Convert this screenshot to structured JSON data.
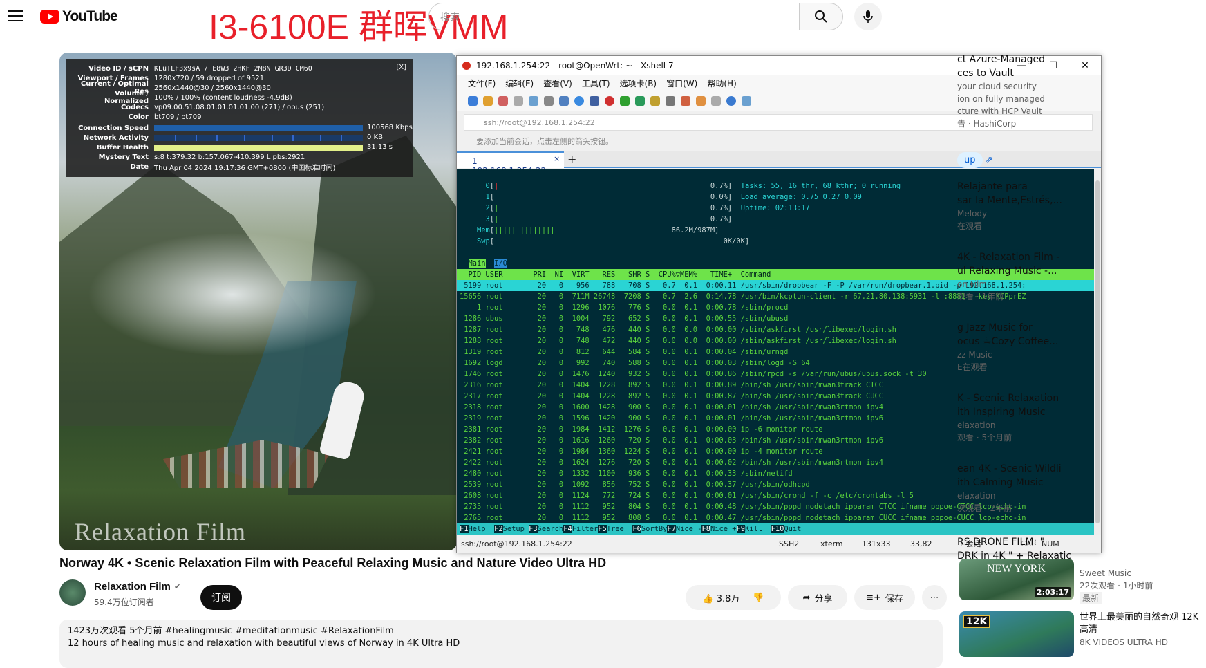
{
  "youtube": {
    "brand": "YouTube",
    "overlay": "I3-6100E 群晖VMM",
    "search_placeholder": "搜索"
  },
  "stats": {
    "close": "[X]",
    "rows": [
      {
        "k": "Video ID / sCPN",
        "v": "KLuTLF3x9sA / E8W3 2HKF 2M8N GR3D CM60"
      },
      {
        "k": "Viewport / Frames",
        "v": "1280x720 / 59 dropped of 9521"
      },
      {
        "k": "Current / Optimal Res",
        "v": "2560x1440@30 / 2560x1440@30"
      },
      {
        "k": "Volume / Normalized",
        "v": "100% / 100% (content loudness -4.9dB)"
      },
      {
        "k": "Codecs",
        "v": "vp09.00.51.08.01.01.01.01.00 (271) / opus (251)"
      },
      {
        "k": "Color",
        "v": "bt709 / bt709"
      }
    ],
    "speed": {
      "k": "Connection Speed",
      "v": "100568 Kbps"
    },
    "activity": {
      "k": "Network Activity",
      "v": "0 KB"
    },
    "buffer": {
      "k": "Buffer Health",
      "v": "31.13 s"
    },
    "mystery": {
      "k": "Mystery Text",
      "v": "s:8 t:379.32 b:157.067-410.399 L pbs:2921"
    },
    "date": {
      "k": "Date",
      "v": "Thu Apr 04 2024 19:17:36 GMT+0800 (中国标准时间)"
    }
  },
  "watermark": "Relaxation Film",
  "xshell": {
    "title": "192.168.1.254:22 - root@OpenWrt: ~ - Xshell 7",
    "menu": [
      "文件(F)",
      "编辑(E)",
      "查看(V)",
      "工具(T)",
      "选项卡(B)",
      "窗口(W)",
      "帮助(H)"
    ],
    "address": "ssh://root@192.168.1.254:22",
    "hint": "要添加当前会话，点击左侧的箭头按钮。",
    "tab": "1 192.168.1.254:22",
    "status": {
      "conn": "ssh://root@192.168.1.254:22",
      "proto": "SSH2",
      "term": "xterm",
      "size": "131x33",
      "pos": "33,82",
      "sessions": "1 会话",
      "caps": "CAP",
      "num": "NUM"
    },
    "terminal": {
      "cpus": [
        {
          "n": "0",
          "bar": "|",
          "pct": "0.7%"
        },
        {
          "n": "1",
          "bar": "",
          "pct": "0.0%"
        },
        {
          "n": "2",
          "bar": "|",
          "pct": "0.7%"
        },
        {
          "n": "3",
          "bar": "|",
          "pct": "0.7%"
        }
      ],
      "mem": {
        "label": "Mem",
        "bar": "||||||||||||||",
        "val": "86.2M/987M"
      },
      "swp": {
        "label": "Swp",
        "bar": "",
        "val": "0K/0K"
      },
      "tasks": "Tasks: 55, 16 thr, 68 kthr; 0 running",
      "load": "Load average: 0.75 0.27 0.09",
      "uptime": "Uptime: 02:13:17",
      "tabs": [
        "Main",
        "I/O"
      ],
      "header": "  PID USER       PRI  NI  VIRT   RES   SHR S  CPU%▽MEM%   TIME+  Command",
      "rows": [
        " 5199 root        20   0   956   788   708 S   0.7  0.1  0:00.11 /usr/sbin/dropbear -F -P /var/run/dropbear.1.pid -p 192.168.1.254:",
        "15656 root        20   0  711M 26748  7208 S   0.7  2.6  0:14.78 /usr/bin/kcptun-client -r 67.21.80.138:5931 -l :8881 --key KCPprEZ",
        "    1 root        20   0  1296  1076   776 S   0.0  0.1  0:00.78 /sbin/procd",
        " 1286 ubus        20   0  1004   792   652 S   0.0  0.1  0:00.55 /sbin/ubusd",
        " 1287 root        20   0   748   476   440 S   0.0  0.0  0:00.00 /sbin/askfirst /usr/libexec/login.sh",
        " 1288 root        20   0   748   472   440 S   0.0  0.0  0:00.00 /sbin/askfirst /usr/libexec/login.sh",
        " 1319 root        20   0   812   644   584 S   0.0  0.1  0:00.04 /sbin/urngd",
        " 1692 logd        20   0   992   740   588 S   0.0  0.1  0:00.03 /sbin/logd -S 64",
        " 1746 root        20   0  1476  1240   932 S   0.0  0.1  0:00.86 /sbin/rpcd -s /var/run/ubus/ubus.sock -t 30",
        " 2316 root        20   0  1404  1228   892 S   0.0  0.1  0:00.89 /bin/sh /usr/sbin/mwan3track CTCC",
        " 2317 root        20   0  1404  1228   892 S   0.0  0.1  0:00.87 /bin/sh /usr/sbin/mwan3track CUCC",
        " 2318 root        20   0  1600  1428   900 S   0.0  0.1  0:00.01 /bin/sh /usr/sbin/mwan3rtmon ipv4",
        " 2319 root        20   0  1596  1420   900 S   0.0  0.1  0:00.01 /bin/sh /usr/sbin/mwan3rtmon ipv6",
        " 2381 root        20   0  1984  1412  1276 S   0.0  0.1  0:00.00 ip -6 monitor route",
        " 2382 root        20   0  1616  1260   720 S   0.0  0.1  0:00.03 /bin/sh /usr/sbin/mwan3rtmon ipv6",
        " 2421 root        20   0  1984  1360  1224 S   0.0  0.1  0:00.00 ip -4 monitor route",
        " 2422 root        20   0  1624  1276   720 S   0.0  0.1  0:00.02 /bin/sh /usr/sbin/mwan3rtmon ipv4",
        " 2480 root        20   0  1332  1100   936 S   0.0  0.1  0:00.33 /sbin/netifd",
        " 2539 root        20   0  1092   856   752 S   0.0  0.1  0:00.37 /usr/sbin/odhcpd",
        " 2608 root        20   0  1124   772   724 S   0.0  0.1  0:00.01 /usr/sbin/crond -f -c /etc/crontabs -l 5",
        " 2735 root        20   0  1112   952   804 S   0.0  0.1  0:00.48 /usr/sbin/pppd nodetach ipparam CTCC ifname pppoe-CTCC lcp-echo-in",
        " 2765 root        20   0  1112   952   808 S   0.0  0.1  0:00.47 /usr/sbin/pppd nodetach ipparam CUCC ifname pppoe-CUCC lcp-echo-in"
      ],
      "fkeys": [
        {
          "k": "F1",
          "l": "Help  "
        },
        {
          "k": "F2",
          "l": "Setup "
        },
        {
          "k": "F3",
          "l": "Search"
        },
        {
          "k": "F4",
          "l": "Filter"
        },
        {
          "k": "F5",
          "l": "Tree  "
        },
        {
          "k": "F6",
          "l": "SortBy"
        },
        {
          "k": "F7",
          "l": "Nice -"
        },
        {
          "k": "F8",
          "l": "Nice +"
        },
        {
          "k": "F9",
          "l": "Kill  "
        },
        {
          "k": "F10",
          "l": "Quit"
        }
      ]
    }
  },
  "video": {
    "title": "Norway 4K • Scenic Relaxation Film with Peaceful Relaxing Music and Nature Video Ultra HD",
    "channel": "Relaxation Film",
    "subs": "59.4万位订阅者",
    "subscribe": "订阅",
    "likes": "3.8万",
    "share": "分享",
    "save": "保存",
    "views": "1423万次观看  5个月前  #healingmusic #meditationmusic #RelaxationFilm",
    "desc": "12 hours of healing music and relaxation with beautiful views of Norway in 4K Ultra HD"
  },
  "sidebar": [
    {
      "t": "ct Azure-Managed",
      "t2": "ces to Vault",
      "m": "your cloud security",
      "m2": "ion on fully managed",
      "m3": "cture with HCP Vault",
      "m4": "告 · HashiCorp"
    },
    {
      "btn": "up"
    },
    {
      "t": "Relajante para",
      "t2": "sar la Mente,Estrés,...",
      "m": "Melody",
      "m2": "在观看"
    },
    {
      "t": "4K - Relaxation Film -",
      "t2": "ul Relaxing Music -...",
      "m": "on Film",
      "m2": "观看 · 1年前"
    },
    {
      "t": "g Jazz Music for",
      "t2": "ocus ☕Cozy Coffee...",
      "m": "zz Music",
      "m2": "E在观看"
    },
    {
      "t": "K - Scenic Relaxation",
      "t2": "ith Inspiring Music",
      "m": "elaxation",
      "m2": "观看 · 5个月前"
    },
    {
      "t": "ean 4K - Scenic Wildli",
      "t2": "ith Calming Music",
      "m": "elaxation",
      "m2": "次观看 · 2年前"
    },
    {
      "t": "RS DRONE FILM: \"",
      "t2": "DRK in 4K \" + Relaxatic"
    },
    {
      "ch": "Sweet Music",
      "m": "22次观看 · 1小时前",
      "badge": "最新",
      "dur": "2:03:17",
      "thumbtxt": "NEW YORK"
    },
    {
      "t": "世界上最美丽的自然奇观 12K",
      "t2": "高清",
      "ch": "8K VIDEOS ULTRA HD",
      "thumbtxt": "12K"
    }
  ]
}
